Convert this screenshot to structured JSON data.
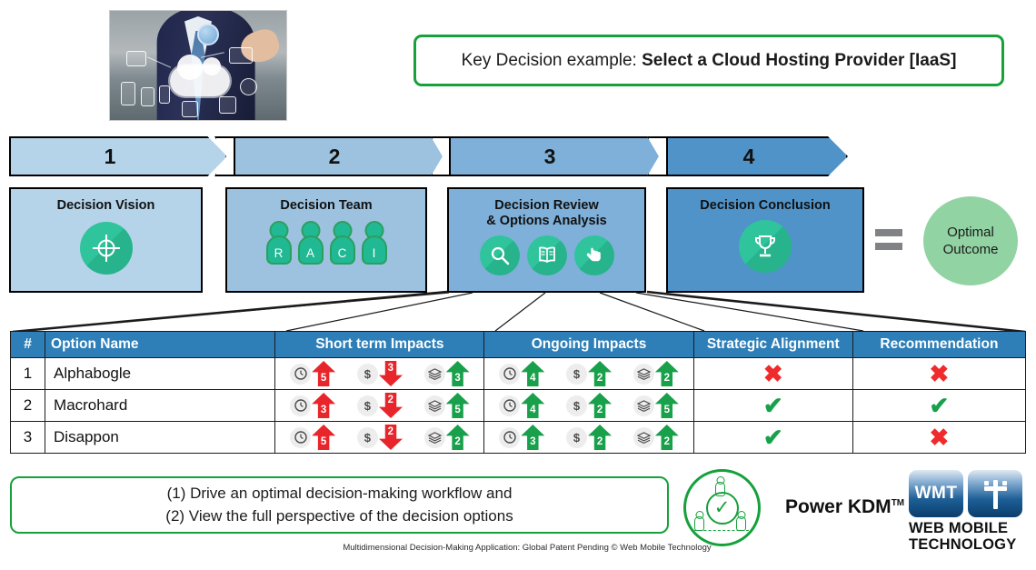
{
  "banner": {
    "prefix": "Key Decision example: ",
    "decision": "Select a Cloud Hosting Provider [IaaS]"
  },
  "photo": {
    "alt": "businessman-cloud-computing-photo"
  },
  "process": {
    "steps": [
      {
        "number": "1",
        "title": "Decision Vision",
        "icon": "target-icon",
        "color": "#b5d3e9"
      },
      {
        "number": "2",
        "title": "Decision Team",
        "icon": "raci-people-icon",
        "color": "#9cc2e0"
      },
      {
        "number": "3",
        "title_line1": "Decision Review",
        "title_line2": "& Options Analysis",
        "icon": "magnifier-book-hand-icons",
        "color": "#7fb0d9"
      },
      {
        "number": "4",
        "title": "Decision Conclusion",
        "icon": "trophy-icon",
        "color": "#4f93c9"
      }
    ],
    "raci": [
      "R",
      "A",
      "C",
      "I"
    ],
    "equals_label": "=",
    "outcome_line1": "Optimal",
    "outcome_line2": "Outcome",
    "outcome_color": "#92d3a3"
  },
  "table": {
    "headers": [
      "#",
      "Option Name",
      "Short term Impacts",
      "Ongoing Impacts",
      "Strategic Alignment",
      "Recommendation"
    ],
    "header_color": "#2e7fb8",
    "metric_icons": [
      "clock-icon",
      "dollar-icon",
      "layers-icon"
    ],
    "rows": [
      {
        "num": "1",
        "name": "Alphabogle",
        "short_term": [
          {
            "icon": "clock-icon",
            "value": "5",
            "dir": "up",
            "color": "#e8252a"
          },
          {
            "icon": "dollar-icon",
            "value": "3",
            "dir": "down",
            "color": "#e8252a"
          },
          {
            "icon": "layers-icon",
            "value": "3",
            "dir": "up",
            "color": "#18a04a"
          }
        ],
        "ongoing": [
          {
            "icon": "clock-icon",
            "value": "4",
            "dir": "up",
            "color": "#18a04a"
          },
          {
            "icon": "dollar-icon",
            "value": "2",
            "dir": "up",
            "color": "#18a04a"
          },
          {
            "icon": "layers-icon",
            "value": "2",
            "dir": "up",
            "color": "#18a04a"
          }
        ],
        "strategic": "x",
        "recommendation": "x"
      },
      {
        "num": "2",
        "name": "Macrohard",
        "short_term": [
          {
            "icon": "clock-icon",
            "value": "3",
            "dir": "up",
            "color": "#e8252a"
          },
          {
            "icon": "dollar-icon",
            "value": "2",
            "dir": "down",
            "color": "#e8252a"
          },
          {
            "icon": "layers-icon",
            "value": "5",
            "dir": "up",
            "color": "#18a04a"
          }
        ],
        "ongoing": [
          {
            "icon": "clock-icon",
            "value": "4",
            "dir": "up",
            "color": "#18a04a"
          },
          {
            "icon": "dollar-icon",
            "value": "2",
            "dir": "up",
            "color": "#18a04a"
          },
          {
            "icon": "layers-icon",
            "value": "5",
            "dir": "up",
            "color": "#18a04a"
          }
        ],
        "strategic": "check",
        "recommendation": "check"
      },
      {
        "num": "3",
        "name": "Disappon",
        "short_term": [
          {
            "icon": "clock-icon",
            "value": "5",
            "dir": "up",
            "color": "#e8252a"
          },
          {
            "icon": "dollar-icon",
            "value": "2",
            "dir": "down",
            "color": "#e8252a"
          },
          {
            "icon": "layers-icon",
            "value": "2",
            "dir": "up",
            "color": "#18a04a"
          }
        ],
        "ongoing": [
          {
            "icon": "clock-icon",
            "value": "3",
            "dir": "up",
            "color": "#18a04a"
          },
          {
            "icon": "dollar-icon",
            "value": "2",
            "dir": "up",
            "color": "#18a04a"
          },
          {
            "icon": "layers-icon",
            "value": "2",
            "dir": "up",
            "color": "#18a04a"
          }
        ],
        "strategic": "check",
        "recommendation": "x"
      }
    ],
    "marks": {
      "x": "✖",
      "check": "✔"
    }
  },
  "footer": {
    "line1": "(1) Drive an optimal decision-making workflow and",
    "line2": "(2) View the full perspective of the decision options",
    "legal": "Multidimensional Decision-Making Application: Global Patent Pending © Web Mobile Technology",
    "brand": "Power KDM",
    "brand_tm": "TM",
    "brand_color": "#16a03c",
    "wmt_tile1": "WMT",
    "wmt_tile2": "cross-icon",
    "wmt_line1": "WEB  MOBILE",
    "wmt_line2": "TECHNOLOGY"
  }
}
